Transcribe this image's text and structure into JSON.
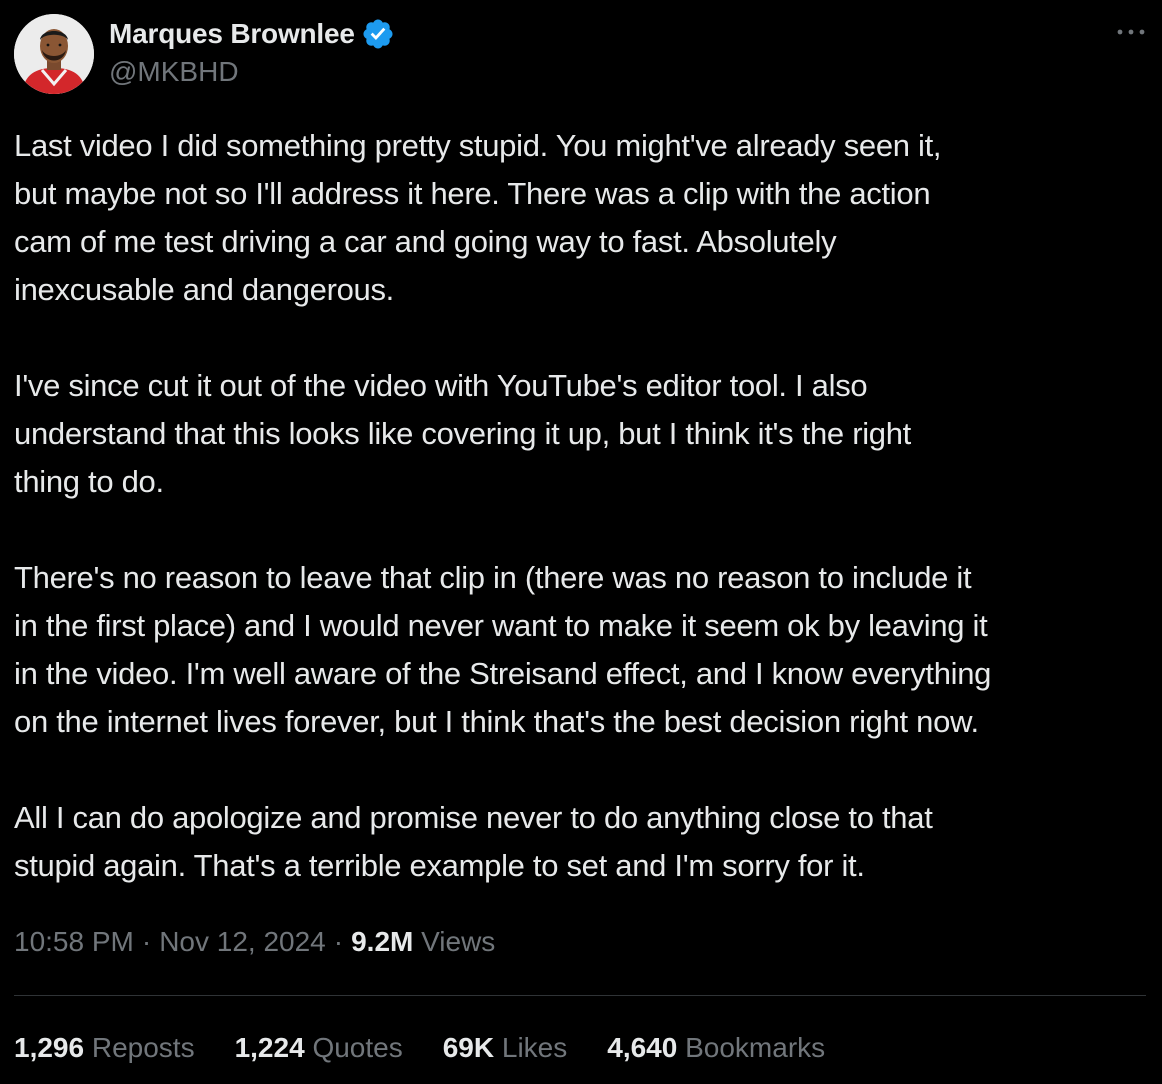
{
  "author": {
    "display_name": "Marques Brownlee",
    "handle": "@MKBHD",
    "verified": true,
    "verified_color": "#1d9bf0"
  },
  "tweet": {
    "paragraphs": [
      "Last video I did something pretty stupid. You might've already seen it,\nbut maybe not so I'll address it here. There was a clip with the action\ncam of me test driving a car and going way to fast. Absolutely\ninexcusable and dangerous.",
      "I've since cut it out of the video with YouTube's editor tool. I also\nunderstand that this looks like covering it up, but I think it's the right\nthing to do.",
      "There's no reason to leave that clip in (there was no reason to include it\nin the first place) and I would never want to make it seem ok by leaving it\nin the video. I'm well aware of the Streisand effect, and I know everything\non the internet lives forever, but I think that's the best decision right now.",
      "All I can do apologize and promise never to do anything close to that\nstupid again. That's a terrible example to set and I'm sorry for it."
    ],
    "time": "10:58 PM",
    "date": "Nov 12, 2024",
    "separator": "·",
    "views_count": "9.2M",
    "views_label": "Views"
  },
  "stats": [
    {
      "count": "1,296",
      "label": "Reposts"
    },
    {
      "count": "1,224",
      "label": "Quotes"
    },
    {
      "count": "69K",
      "label": "Likes"
    },
    {
      "count": "4,640",
      "label": "Bookmarks"
    }
  ],
  "icons": {
    "verified": "verified-badge-icon",
    "more": "more-options-icon"
  },
  "colors": {
    "background": "#000000",
    "text_primary": "#e7e9ea",
    "text_secondary": "#71767b",
    "divider": "#2f3336"
  }
}
